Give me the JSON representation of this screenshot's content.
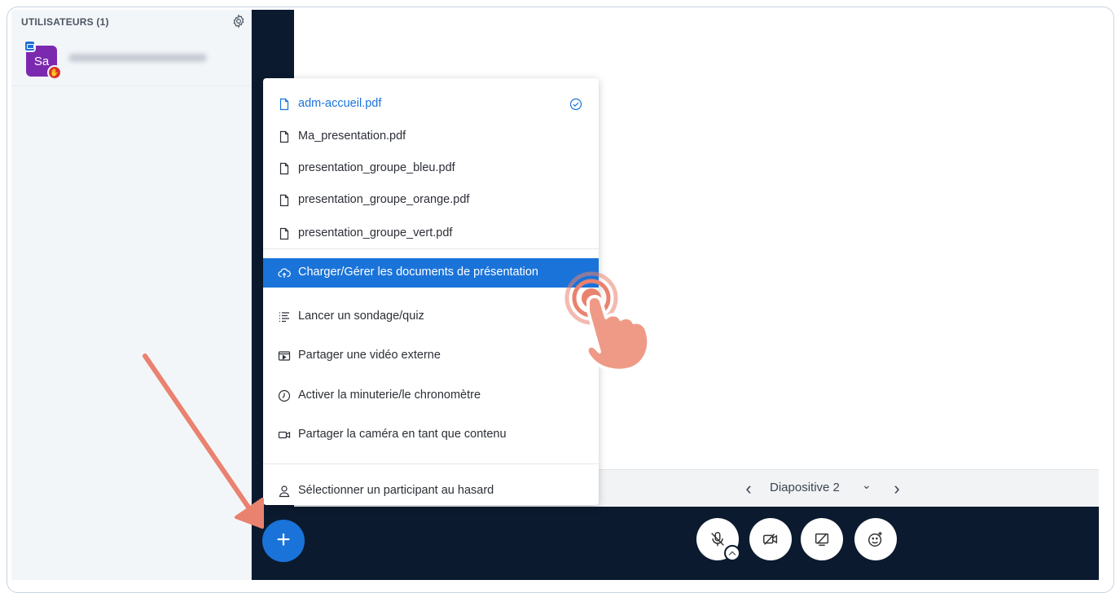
{
  "users_panel": {
    "header": "UTILISATEURS (1)",
    "user": {
      "initials": "Sa",
      "name_blurred": true
    }
  },
  "menu": {
    "files": [
      {
        "label": "adm-accueil.pdf",
        "active": true
      },
      {
        "label": "Ma_presentation.pdf",
        "active": false
      },
      {
        "label": "presentation_groupe_bleu.pdf",
        "active": false
      },
      {
        "label": "presentation_groupe_orange.pdf",
        "active": false
      },
      {
        "label": "presentation_groupe_vert.pdf",
        "active": false
      }
    ],
    "actions": [
      {
        "label": "Charger/Gérer les documents de présentation",
        "icon": "cloud-upload-icon",
        "highlight": true
      },
      {
        "label": "Lancer un sondage/quiz",
        "icon": "poll-icon"
      },
      {
        "label": "Partager une vidéo externe",
        "icon": "video-icon"
      },
      {
        "label": "Activer la minuterie/le chronomètre",
        "icon": "timer-icon"
      },
      {
        "label": "Partager la caméra en tant que contenu",
        "icon": "camera-icon"
      }
    ],
    "footer": {
      "label": "Sélectionner un participant au hasard",
      "icon": "user-icon"
    }
  },
  "slide_controls": {
    "label": "Diapositive 2"
  },
  "colors": {
    "accent": "#1a73d9",
    "dark": "#0b1a2e",
    "annotation": "#e9826f"
  }
}
